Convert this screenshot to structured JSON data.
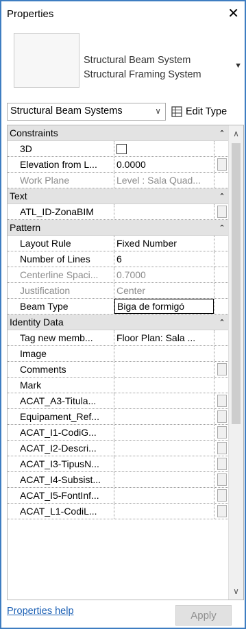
{
  "window": {
    "title": "Properties"
  },
  "type_selector": {
    "family": "Structural Beam System",
    "type": "Structural Framing System"
  },
  "filter": {
    "selected": "Structural Beam Systems",
    "edit_type_label": "Edit Type"
  },
  "groups": [
    {
      "name": "Constraints",
      "rows": [
        {
          "name": "3D",
          "kind": "checkbox",
          "checked": false
        },
        {
          "name": "Elevation from L...",
          "value": "0.0000",
          "btn": true
        },
        {
          "name": "Work Plane",
          "value": "Level : Sala Quad...",
          "disabled": true
        }
      ]
    },
    {
      "name": "Text",
      "rows": [
        {
          "name": "ATL_ID-ZonaBIM",
          "value": "",
          "btn": true
        }
      ]
    },
    {
      "name": "Pattern",
      "rows": [
        {
          "name": "Layout Rule",
          "value": "Fixed Number"
        },
        {
          "name": "Number of Lines",
          "value": "6"
        },
        {
          "name": "Centerline Spaci...",
          "value": "0.7000",
          "disabled": true
        },
        {
          "name": "Justification",
          "value": "Center",
          "disabled": true
        },
        {
          "name": "Beam Type",
          "value": "Biga de formigó",
          "editing": true
        }
      ]
    },
    {
      "name": "Identity Data",
      "rows": [
        {
          "name": "Tag new memb...",
          "value": "Floor Plan: Sala ..."
        },
        {
          "name": "Image",
          "value": ""
        },
        {
          "name": "Comments",
          "value": "",
          "btn": true
        },
        {
          "name": "Mark",
          "value": ""
        },
        {
          "name": "ACAT_A3-Titula...",
          "value": "",
          "btn": true
        },
        {
          "name": "Equipament_Ref...",
          "value": "",
          "btn": true
        },
        {
          "name": "ACAT_I1-CodiG...",
          "value": "",
          "btn": true
        },
        {
          "name": "ACAT_I2-Descri...",
          "value": "",
          "btn": true
        },
        {
          "name": "ACAT_I3-TipusN...",
          "value": "",
          "btn": true
        },
        {
          "name": "ACAT_I4-Subsist...",
          "value": "",
          "btn": true
        },
        {
          "name": "ACAT_I5-FontInf...",
          "value": "",
          "btn": true
        },
        {
          "name": "ACAT_L1-CodiL...",
          "value": "",
          "btn": true
        }
      ]
    }
  ],
  "footer": {
    "help_label": "Properties help",
    "apply_label": "Apply"
  },
  "icons": {
    "close": "close-icon",
    "collapse": "chevron-up-icon",
    "edit_type": "edit-type-icon"
  }
}
